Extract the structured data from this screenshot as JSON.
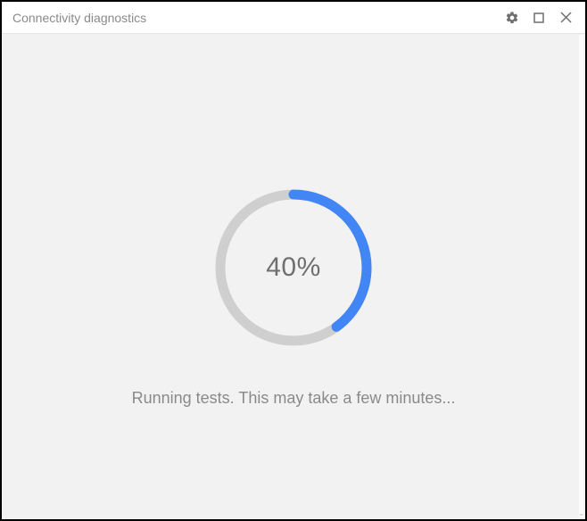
{
  "window": {
    "title": "Connectivity diagnostics"
  },
  "progress": {
    "percent": 40,
    "label": "40%"
  },
  "status": {
    "message": "Running tests. This may take a few minutes..."
  },
  "colors": {
    "accent": "#4285f4",
    "track": "#cfcfcf",
    "text_muted": "#8a8a8a"
  }
}
